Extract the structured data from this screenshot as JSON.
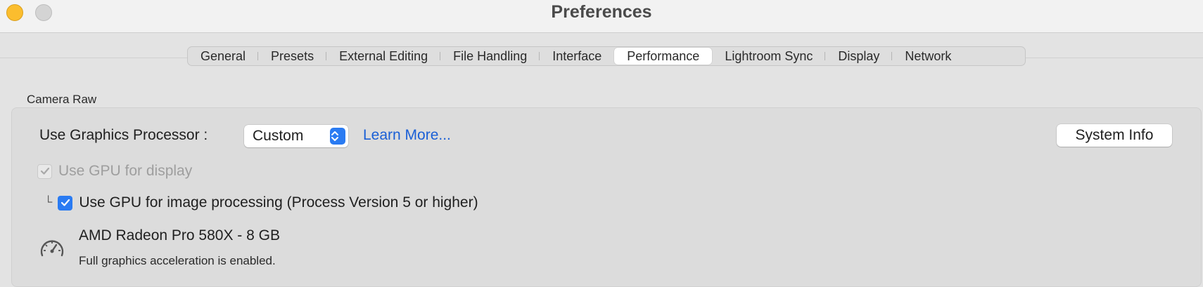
{
  "window": {
    "title": "Preferences"
  },
  "tabs": [
    {
      "label": "General"
    },
    {
      "label": "Presets"
    },
    {
      "label": "External Editing"
    },
    {
      "label": "File Handling"
    },
    {
      "label": "Interface"
    },
    {
      "label": "Performance",
      "active": true
    },
    {
      "label": "Lightroom Sync"
    },
    {
      "label": "Display"
    },
    {
      "label": "Network"
    }
  ],
  "camera_raw": {
    "section_label": "Camera Raw",
    "gpu_label": "Use Graphics Processor :",
    "gpu_select_value": "Custom",
    "learn_more": "Learn More...",
    "system_info_button": "System Info",
    "use_gpu_display": {
      "label": "Use GPU for display",
      "checked": true,
      "disabled": true
    },
    "use_gpu_processing": {
      "label": "Use GPU for image processing (Process Version 5 or higher)",
      "checked": true
    },
    "gpu_name": "AMD Radeon Pro 580X - 8 GB",
    "gpu_status": "Full graphics acceleration is enabled."
  },
  "icons": {
    "gauge": "gauge-icon",
    "checkmark": "checkmark-icon",
    "tree_connector": "tree-connector-icon",
    "stepper_arrows": "chevron-up-down-icon"
  },
  "colors": {
    "accent": "#2a7bf2",
    "link": "#1a5fd6",
    "traffic_yellow": "#fbbd2e"
  }
}
